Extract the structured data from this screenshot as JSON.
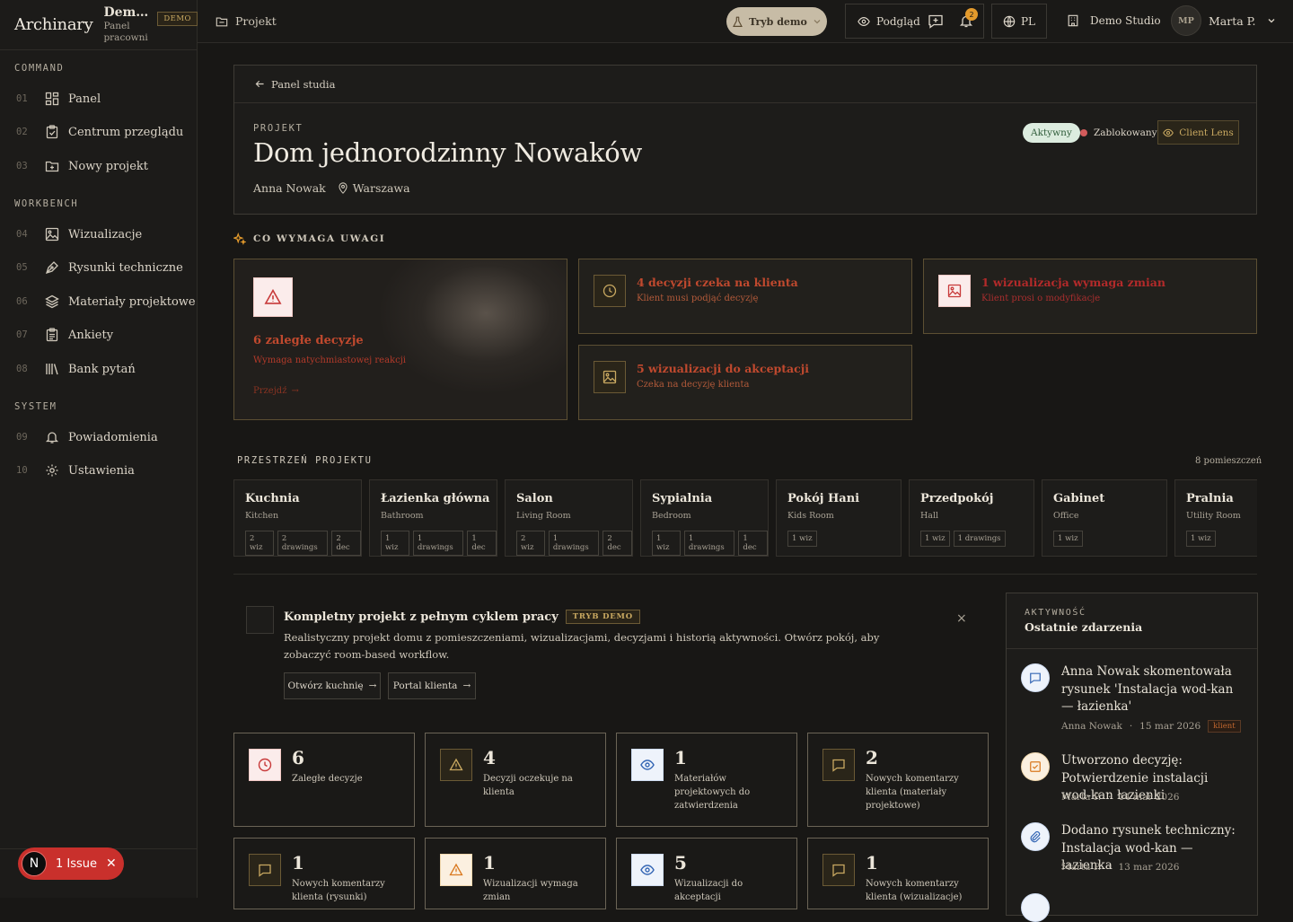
{
  "brand": {
    "name": "Archinary",
    "workspace": "Dem…",
    "workspace_sub": "Panel pracowni",
    "badge": "DEMO"
  },
  "sidebar": {
    "sections": [
      "COMMAND",
      "WORKBENCH",
      "SYSTEM"
    ],
    "items": [
      {
        "num": "01",
        "label": "Panel"
      },
      {
        "num": "02",
        "label": "Centrum przeglądu"
      },
      {
        "num": "03",
        "label": "Nowy projekt"
      },
      {
        "num": "04",
        "label": "Wizualizacje"
      },
      {
        "num": "05",
        "label": "Rysunki techniczne"
      },
      {
        "num": "06",
        "label": "Materiały projektowe"
      },
      {
        "num": "07",
        "label": "Ankiety"
      },
      {
        "num": "08",
        "label": "Bank pytań"
      },
      {
        "num": "09",
        "label": "Powiadomienia"
      },
      {
        "num": "10",
        "label": "Ustawienia"
      }
    ]
  },
  "issue": {
    "letter": "N",
    "label": "1 Issue"
  },
  "topbar": {
    "crumb": "Projekt",
    "demo_mode": "Tryb demo",
    "preview": "Podgląd",
    "notif_count": "2",
    "lang": "PL",
    "studio": "Demo Studio",
    "user_initials": "MP",
    "user_name": "Marta P."
  },
  "project": {
    "back": "Panel studia",
    "label": "PROJEKT",
    "title": "Dom jednorodzinny Nowaków",
    "client": "Anna Nowak",
    "location": "Warszawa",
    "status": "Aktywny",
    "blocked": "Zablokowany",
    "lens": "Client Lens"
  },
  "attention": {
    "heading": "CO WYMAGA UWAGI",
    "main": {
      "title": "6 zaległe decyzje",
      "sub": "Wymaga natychmiastowej reakcji",
      "link": "Przejdź"
    },
    "cards": [
      {
        "title": "4 decyzji czeka na klienta",
        "sub": "Klient musi podjąć decyzję",
        "icon": "clock-icon"
      },
      {
        "title": "1 wizualizacja wymaga zmian",
        "sub": "Klient prosi o modyfikacje",
        "icon": "image-icon"
      },
      {
        "title": "5 wizualizacji do akceptacji",
        "sub": "Czeka na decyzję klienta",
        "icon": "image-icon"
      }
    ]
  },
  "rooms": {
    "heading": "PRZESTRZEŃ PROJEKTU",
    "count": "8 pomieszczeń",
    "items": [
      {
        "name": "Kuchnia",
        "en": "Kitchen",
        "tags": [
          "2 wiz",
          "2 drawings",
          "2 dec"
        ]
      },
      {
        "name": "Łazienka główna",
        "en": "Bathroom",
        "tags": [
          "1 wiz",
          "1 drawings",
          "1 dec"
        ]
      },
      {
        "name": "Salon",
        "en": "Living Room",
        "tags": [
          "2 wiz",
          "1 drawings",
          "2 dec"
        ]
      },
      {
        "name": "Sypialnia",
        "en": "Bedroom",
        "tags": [
          "1 wiz",
          "1 drawings",
          "1 dec"
        ]
      },
      {
        "name": "Pokój Hani",
        "en": "Kids Room",
        "tags": [
          "1 wiz"
        ]
      },
      {
        "name": "Przedpokój",
        "en": "Hall",
        "tags": [
          "1 wiz",
          "1 drawings"
        ]
      },
      {
        "name": "Gabinet",
        "en": "Office",
        "tags": [
          "1 wiz"
        ]
      },
      {
        "name": "Pralnia",
        "en": "Utility Room",
        "tags": [
          "1 wiz"
        ]
      }
    ]
  },
  "demo_banner": {
    "title": "Kompletny projekt z pełnym cyklem pracy",
    "chip": "TRYB DEMO",
    "text": "Realistyczny projekt domu z pomieszczeniami, wizualizacjami, decyzjami i historią aktywności. Otwórz pokój, aby zobaczyć room-based workflow.",
    "btn1": "Otwórz kuchnię",
    "btn2": "Portal klienta",
    "close": "×"
  },
  "stats": [
    {
      "value": "6",
      "label": "Zaległe decyzje",
      "icon": "clock-icon",
      "tone": "red"
    },
    {
      "value": "4",
      "label": "Decyzji oczekuje na klienta",
      "icon": "warning-icon",
      "tone": "dark"
    },
    {
      "value": "1",
      "label": "Materiałów projektowych do zatwierdzenia",
      "icon": "eye-icon",
      "tone": "blue"
    },
    {
      "value": "2",
      "label": "Nowych komentarzy klienta (materiały projektowe)",
      "icon": "comment-icon",
      "tone": "dark"
    },
    {
      "value": "1",
      "label": "Nowych komentarzy klienta (rysunki)",
      "icon": "comment-icon",
      "tone": "dark"
    },
    {
      "value": "1",
      "label": "Wizualizacji wymaga zmian",
      "icon": "warning-icon",
      "tone": "amber"
    },
    {
      "value": "5",
      "label": "Wizualizacji do akceptacji",
      "icon": "eye-icon",
      "tone": "blue"
    },
    {
      "value": "1",
      "label": "Nowych komentarzy klienta (wizualizacje)",
      "icon": "comment-icon",
      "tone": "dark"
    }
  ],
  "activity": {
    "kicker": "AKTYWNOŚĆ",
    "title": "Ostatnie zdarzenia",
    "events": [
      {
        "text": "Anna Nowak skomentowała rysunek 'Instalacja wod-kan — łazienka'",
        "author": "Anna Nowak",
        "date": "15 mar 2026",
        "role": "klient",
        "icon": "comment-icon"
      },
      {
        "text": "Utworzono decyzję: Potwierdzenie instalacji wod-kan łazienki",
        "author": "Marta P.",
        "date": "14 mar 2026",
        "icon": "checkbox-icon"
      },
      {
        "text": "Dodano rysunek techniczny: Instalacja wod-kan — łazienka",
        "author": "Marta P.",
        "date": "13 mar 2026",
        "icon": "paperclip-icon"
      }
    ]
  }
}
